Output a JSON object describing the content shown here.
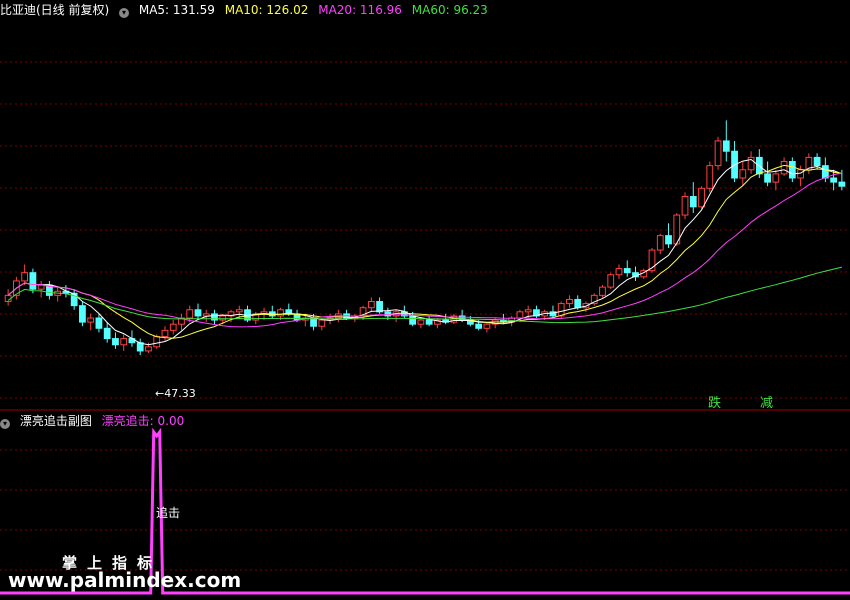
{
  "main_header": {
    "title": "比亚迪(日线 前复权)",
    "ma5": "MA5: 131.59",
    "ma10": "MA10: 126.02",
    "ma20": "MA20: 116.96",
    "ma60": "MA60: 96.23"
  },
  "sub_header": {
    "title": "漂亮追击副图",
    "value": "漂亮追击: 0.00"
  },
  "annotations": {
    "low_price": "47.33",
    "signal": "追击",
    "mark_1": "跌",
    "mark_2": "减"
  },
  "watermark": {
    "cn": "掌上指标",
    "url": "www.palmindex.com"
  },
  "colors": {
    "up": "#ff4040",
    "down": "#54ffff",
    "ma5": "#ffffff",
    "ma10": "#ffff40",
    "ma20": "#ff40ff",
    "ma60": "#40e040",
    "indicator": "#ff40ff",
    "grid": "#800000"
  },
  "chart_data": [
    {
      "type": "candlestick",
      "title": "比亚迪(日线 前复权)",
      "ylim": [
        30,
        200
      ],
      "candles": [
        [
          72,
          78,
          70,
          75
        ],
        [
          75,
          84,
          73,
          82
        ],
        [
          82,
          90,
          80,
          86
        ],
        [
          86,
          88,
          76,
          78
        ],
        [
          78,
          82,
          74,
          80
        ],
        [
          80,
          82,
          73,
          75
        ],
        [
          75,
          79,
          72,
          77
        ],
        [
          77,
          80,
          74,
          76
        ],
        [
          76,
          78,
          68,
          70
        ],
        [
          70,
          72,
          60,
          62
        ],
        [
          62,
          66,
          58,
          64
        ],
        [
          64,
          66,
          57,
          59
        ],
        [
          59,
          62,
          52,
          54
        ],
        [
          54,
          57,
          49,
          51
        ],
        [
          51,
          56,
          48,
          54
        ],
        [
          54,
          58,
          50,
          52
        ],
        [
          52,
          54,
          46,
          48
        ],
        [
          48,
          52,
          47,
          50
        ],
        [
          50,
          56,
          49,
          55
        ],
        [
          55,
          60,
          53,
          58
        ],
        [
          58,
          63,
          56,
          61
        ],
        [
          61,
          66,
          58,
          64
        ],
        [
          64,
          70,
          62,
          68
        ],
        [
          68,
          71,
          63,
          65
        ],
        [
          65,
          68,
          62,
          66
        ],
        [
          66,
          68,
          61,
          63
        ],
        [
          63,
          66,
          61,
          65
        ],
        [
          65,
          68,
          62,
          67
        ],
        [
          67,
          70,
          64,
          68
        ],
        [
          68,
          70,
          62,
          63
        ],
        [
          63,
          67,
          61,
          66
        ],
        [
          66,
          69,
          63,
          67
        ],
        [
          67,
          70,
          64,
          65
        ],
        [
          65,
          69,
          63,
          68
        ],
        [
          68,
          71,
          65,
          66
        ],
        [
          66,
          68,
          62,
          63
        ],
        [
          63,
          66,
          60,
          64
        ],
        [
          64,
          66,
          58,
          60
        ],
        [
          60,
          64,
          58,
          63
        ],
        [
          63,
          66,
          61,
          64
        ],
        [
          64,
          68,
          62,
          66
        ],
        [
          66,
          68,
          63,
          64
        ],
        [
          64,
          66,
          62,
          65
        ],
        [
          65,
          70,
          63,
          69
        ],
        [
          69,
          74,
          67,
          72
        ],
        [
          72,
          74,
          66,
          67
        ],
        [
          67,
          69,
          63,
          65
        ],
        [
          65,
          68,
          62,
          67
        ],
        [
          67,
          70,
          64,
          65
        ],
        [
          65,
          67,
          60,
          61
        ],
        [
          61,
          64,
          59,
          63
        ],
        [
          63,
          65,
          60,
          61
        ],
        [
          61,
          64,
          59,
          63
        ],
        [
          63,
          66,
          61,
          62
        ],
        [
          62,
          66,
          61,
          65
        ],
        [
          65,
          68,
          62,
          63
        ],
        [
          63,
          65,
          60,
          61
        ],
        [
          61,
          63,
          58,
          59
        ],
        [
          59,
          62,
          57,
          61
        ],
        [
          61,
          64,
          59,
          63
        ],
        [
          63,
          66,
          61,
          62
        ],
        [
          62,
          65,
          60,
          64
        ],
        [
          64,
          68,
          62,
          67
        ],
        [
          67,
          70,
          64,
          68
        ],
        [
          68,
          70,
          64,
          65
        ],
        [
          65,
          68,
          63,
          67
        ],
        [
          67,
          70,
          64,
          65
        ],
        [
          65,
          72,
          64,
          71
        ],
        [
          71,
          75,
          69,
          73
        ],
        [
          73,
          75,
          68,
          69
        ],
        [
          69,
          72,
          67,
          71
        ],
        [
          71,
          76,
          70,
          75
        ],
        [
          75,
          80,
          74,
          79
        ],
        [
          79,
          86,
          78,
          85
        ],
        [
          85,
          90,
          83,
          88
        ],
        [
          88,
          92,
          84,
          86
        ],
        [
          86,
          89,
          82,
          84
        ],
        [
          84,
          88,
          83,
          87
        ],
        [
          87,
          98,
          86,
          97
        ],
        [
          97,
          105,
          95,
          104
        ],
        [
          104,
          110,
          98,
          100
        ],
        [
          100,
          115,
          99,
          114
        ],
        [
          114,
          125,
          112,
          123
        ],
        [
          123,
          130,
          115,
          118
        ],
        [
          118,
          128,
          117,
          127
        ],
        [
          127,
          140,
          125,
          138
        ],
        [
          138,
          152,
          136,
          150
        ],
        [
          150,
          160,
          140,
          145
        ],
        [
          145,
          150,
          130,
          132
        ],
        [
          132,
          140,
          128,
          136
        ],
        [
          136,
          145,
          134,
          142
        ],
        [
          142,
          146,
          132,
          134
        ],
        [
          134,
          140,
          128,
          130
        ],
        [
          130,
          136,
          126,
          134
        ],
        [
          134,
          142,
          133,
          140
        ],
        [
          140,
          142,
          130,
          132
        ],
        [
          132,
          138,
          128,
          136
        ],
        [
          136,
          144,
          134,
          142
        ],
        [
          142,
          144,
          136,
          138
        ],
        [
          138,
          142,
          130,
          132
        ],
        [
          132,
          136,
          126,
          130
        ],
        [
          130,
          136,
          126,
          128
        ]
      ],
      "ma_series": [
        {
          "name": "MA5"
        },
        {
          "name": "MA10"
        },
        {
          "name": "MA20"
        },
        {
          "name": "MA60"
        }
      ]
    },
    {
      "type": "line",
      "title": "漂亮追击副图",
      "series": [
        {
          "name": "漂亮追击",
          "spike_index": 18,
          "spike_value": 1,
          "baseline": 0
        }
      ],
      "ylim": [
        0,
        1
      ]
    }
  ]
}
